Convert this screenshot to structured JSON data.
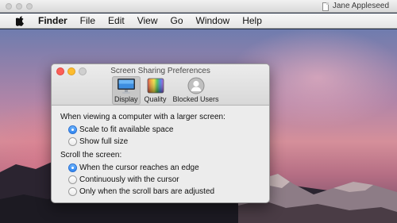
{
  "window": {
    "owner": "Jane Appleseed"
  },
  "menubar": {
    "app_name": "Finder",
    "items": [
      "File",
      "Edit",
      "View",
      "Go",
      "Window",
      "Help"
    ]
  },
  "prefs": {
    "title": "Screen Sharing Preferences",
    "toolbar": [
      {
        "label": "Display",
        "icon": "monitor-icon",
        "selected": true
      },
      {
        "label": "Quality",
        "icon": "color-swatch-icon",
        "selected": false
      },
      {
        "label": "Blocked Users",
        "icon": "user-silhouette-icon",
        "selected": false
      }
    ],
    "display_section": {
      "heading": "When viewing a computer with a larger screen:",
      "options": [
        "Scale to fit available space",
        "Show full size"
      ],
      "selected": "Scale to fit available space"
    },
    "scroll_section": {
      "heading": "Scroll the screen:",
      "options": [
        "When the cursor reaches an edge",
        "Continuously with the cursor",
        "Only when the scroll bars are adjusted"
      ],
      "selected": "When the cursor reaches an edge"
    }
  },
  "colors": {
    "accent": "#2f86f2",
    "close": "#fc5f57",
    "minimize": "#fdbc2e"
  }
}
